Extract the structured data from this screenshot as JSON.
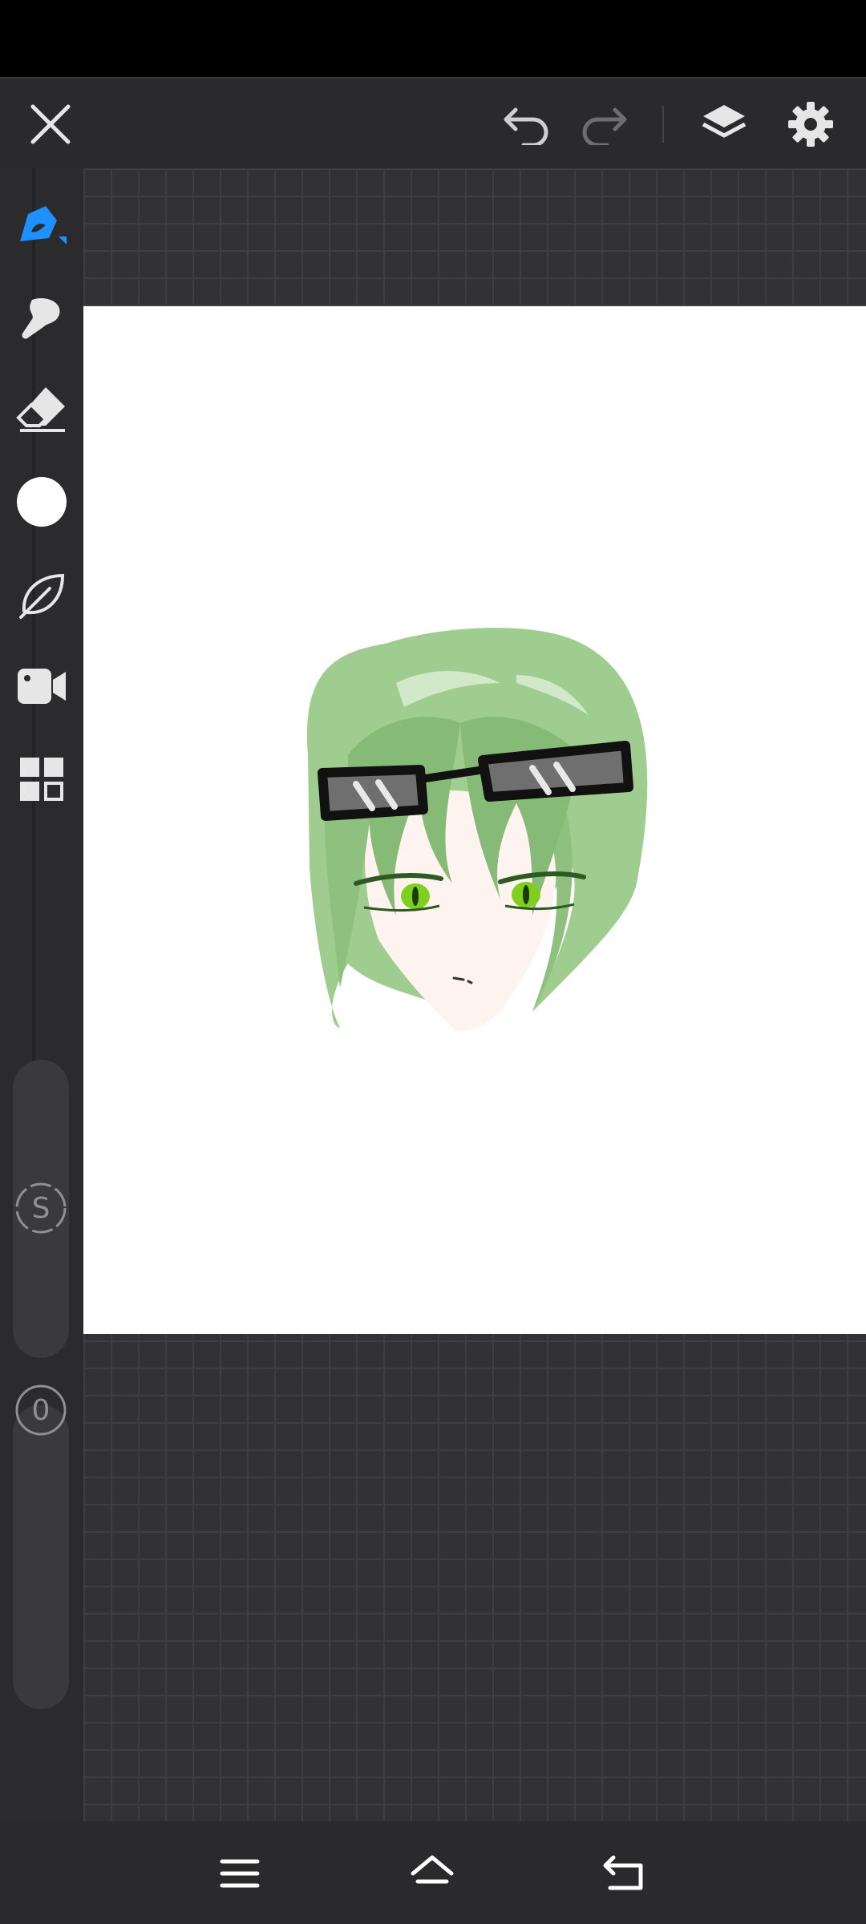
{
  "app": {
    "accent_color": "#1e90ff",
    "canvas_color": "#ffffff"
  },
  "toolbar": {
    "icons": [
      "close-icon",
      "undo-icon",
      "redo-icon",
      "layers-icon",
      "gear-icon"
    ]
  },
  "sidebar": {
    "tools": [
      {
        "id": "pen",
        "icon": "pen-icon",
        "active": true
      },
      {
        "id": "smudge",
        "icon": "smudge-icon"
      },
      {
        "id": "eraser",
        "icon": "eraser-icon"
      },
      {
        "id": "color",
        "icon": "color-swatch-icon",
        "color": "#ffffff"
      },
      {
        "id": "leaf",
        "icon": "leaf-icon"
      },
      {
        "id": "record",
        "icon": "video-camera-icon"
      },
      {
        "id": "gallery",
        "icon": "grid-icon"
      }
    ],
    "size_slider_label": "S",
    "opacity_slider_label": "0"
  },
  "nav": {
    "icons": [
      "menu-icon",
      "home-icon",
      "back-icon"
    ]
  }
}
